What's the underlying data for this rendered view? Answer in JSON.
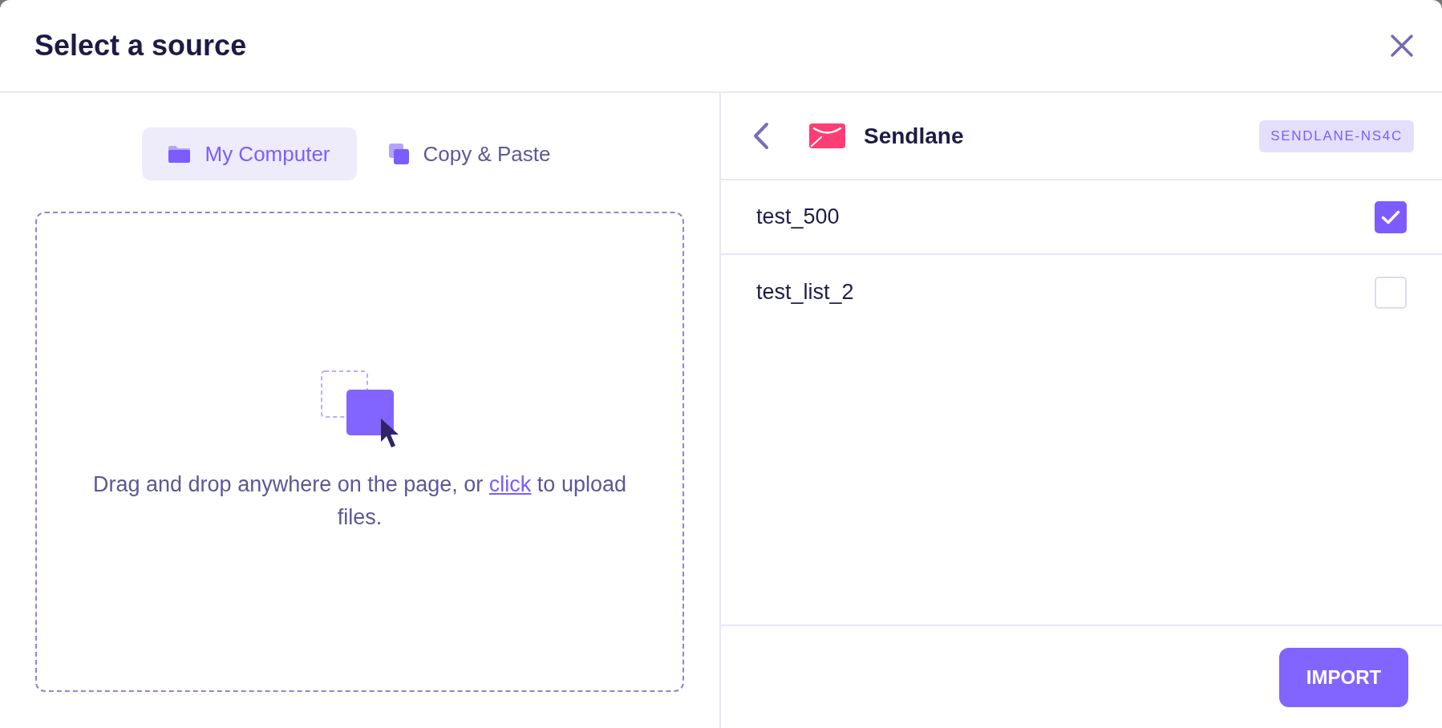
{
  "dialog": {
    "title": "Select a source"
  },
  "source_tabs": [
    {
      "label": "My Computer",
      "selected": true,
      "kind": "folder"
    },
    {
      "label": "Copy & Paste",
      "selected": false,
      "kind": "copy"
    }
  ],
  "dropzone": {
    "text": "Drag and drop anywhere on the page, or ",
    "link": "click",
    "text_end": " to upload files."
  },
  "integration": {
    "name": "Sendlane",
    "badge": "SENDLANE-NS4C"
  },
  "lists": [
    {
      "name": "test_500",
      "checked": true
    },
    {
      "name": "test_list_2",
      "checked": false
    }
  ],
  "footer": {
    "button": "IMPORT"
  }
}
